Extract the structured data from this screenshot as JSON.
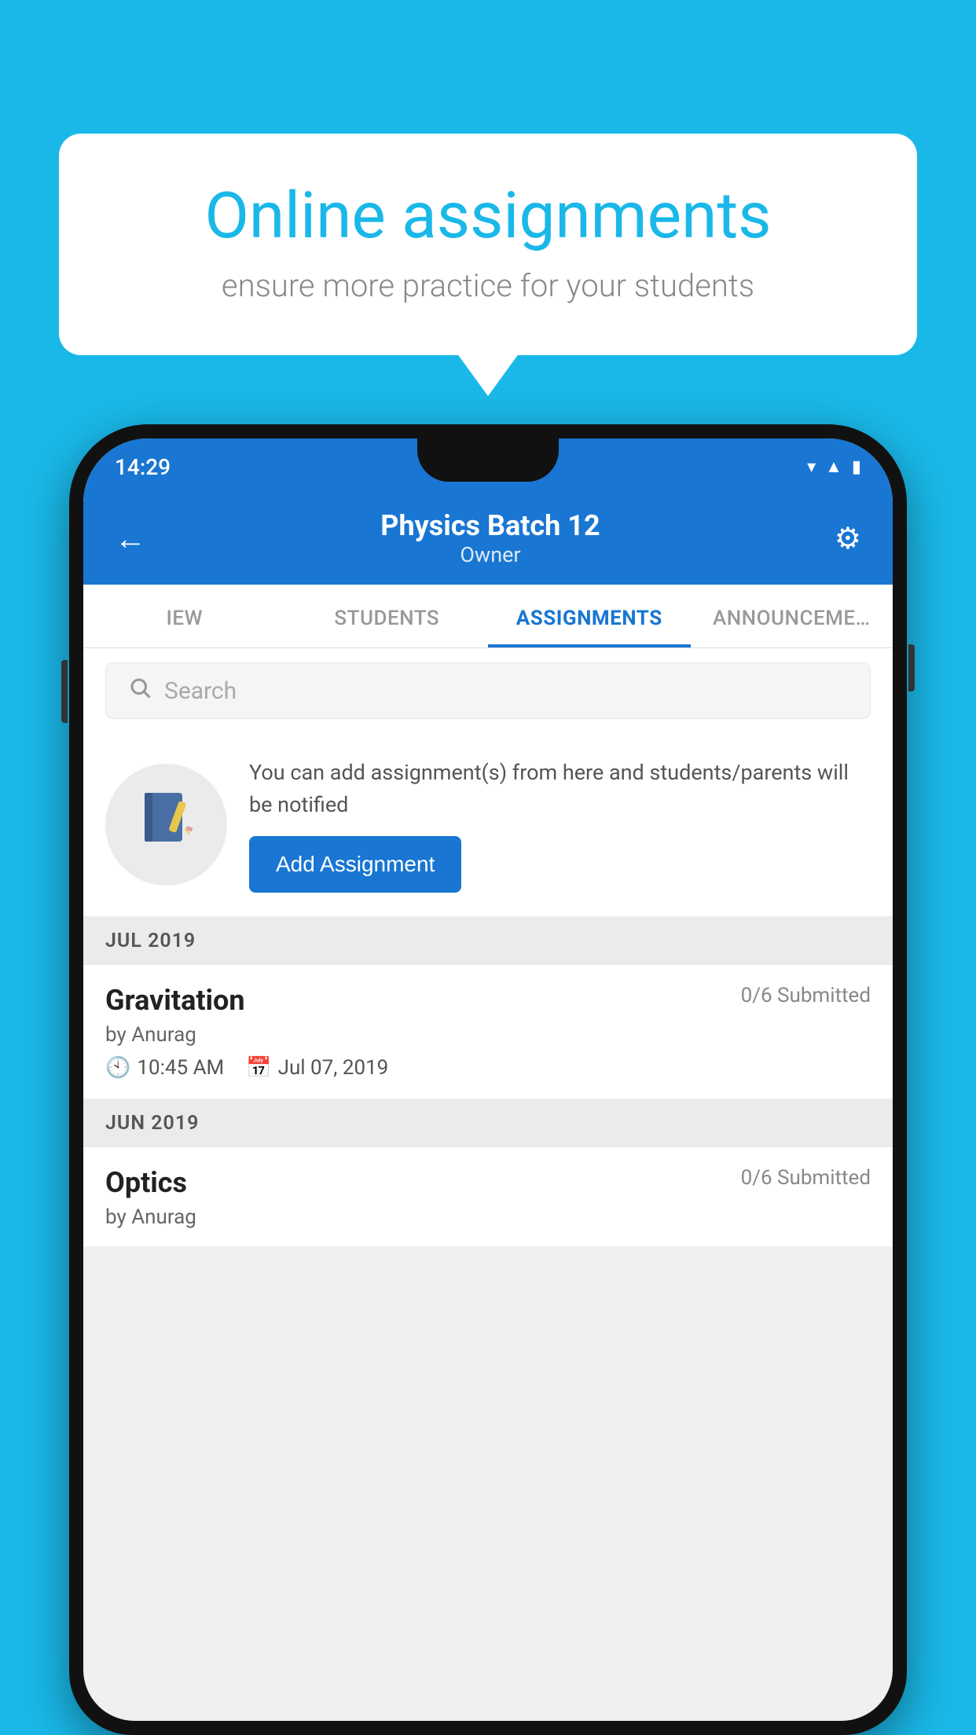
{
  "background_color": "#1ab8e8",
  "speech_bubble": {
    "title": "Online assignments",
    "subtitle": "ensure more practice for your students"
  },
  "status_bar": {
    "time": "14:29",
    "icons": [
      "wifi",
      "signal",
      "battery"
    ]
  },
  "header": {
    "title": "Physics Batch 12",
    "subtitle": "Owner",
    "back_label": "←",
    "settings_label": "⚙"
  },
  "tabs": [
    {
      "label": "IEW",
      "active": false
    },
    {
      "label": "STUDENTS",
      "active": false
    },
    {
      "label": "ASSIGNMENTS",
      "active": true
    },
    {
      "label": "ANNOUNCEME…",
      "active": false
    }
  ],
  "search": {
    "placeholder": "Search"
  },
  "promo": {
    "text": "You can add assignment(s) from here and students/parents will be notified",
    "button_label": "Add Assignment"
  },
  "sections": [
    {
      "label": "JUL 2019",
      "assignments": [
        {
          "title": "Gravitation",
          "submitted": "0/6 Submitted",
          "by": "by Anurag",
          "time": "10:45 AM",
          "date": "Jul 07, 2019"
        }
      ]
    },
    {
      "label": "JUN 2019",
      "assignments": [
        {
          "title": "Optics",
          "submitted": "0/6 Submitted",
          "by": "by Anurag",
          "time": "",
          "date": ""
        }
      ]
    }
  ]
}
